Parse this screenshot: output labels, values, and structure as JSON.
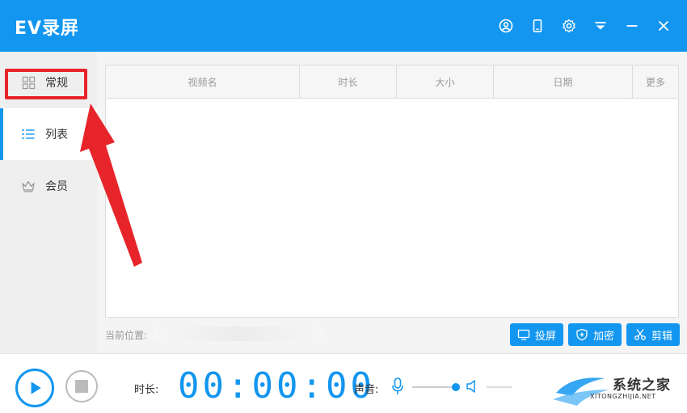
{
  "app": {
    "title": "EV录屏"
  },
  "window_controls": [
    {
      "icon": "user-icon"
    },
    {
      "icon": "mobile-icon"
    },
    {
      "icon": "gear-icon"
    },
    {
      "icon": "menu-dropdown-icon"
    },
    {
      "icon": "minimize-icon"
    },
    {
      "icon": "close-icon"
    }
  ],
  "sidebar": {
    "items": [
      {
        "label": "常规",
        "icon": "grid-icon"
      },
      {
        "label": "列表",
        "icon": "list-icon"
      },
      {
        "label": "会员",
        "icon": "crown-icon"
      }
    ],
    "active_index": 1
  },
  "table": {
    "columns": [
      "视频名",
      "时长",
      "大小",
      "日期",
      "更多"
    ],
    "rows": []
  },
  "location": {
    "label": "当前位置:"
  },
  "actions": {
    "cast_label": "投屏",
    "encrypt_label": "加密",
    "edit_label": "剪辑"
  },
  "bottom": {
    "duration_label": "时长:",
    "timer": "00:00:00",
    "sound_label": "声音:"
  },
  "watermark": {
    "title": "系统之家",
    "subtitle": "XITONGZHIJIA.NET"
  },
  "colors": {
    "accent": "#1296f0",
    "highlight": "#e8242b"
  }
}
